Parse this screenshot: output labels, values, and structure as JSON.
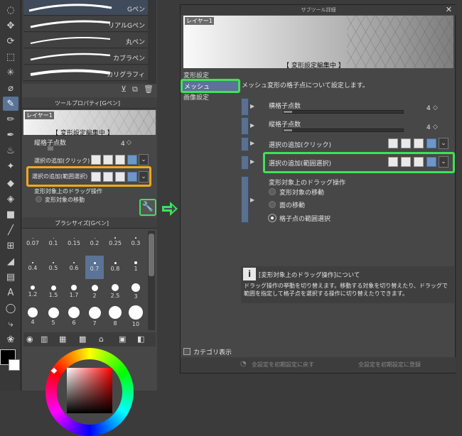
{
  "toolbar_icons": [
    "lasso-icon",
    "move-icon",
    "rotate-icon",
    "rect-select-icon",
    "magic-wand-icon",
    "eyedropper-icon",
    "pen-icon",
    "pencil-icon",
    "brush-icon",
    "airbrush-icon",
    "decoration-icon",
    "eraser-icon",
    "blend-icon",
    "fill-icon",
    "gradient-icon",
    "line-icon",
    "frame-icon",
    "ruler-icon",
    "balloon-icon",
    "text-icon",
    "speech-icon",
    "correct-line-icon",
    "layer-move-icon"
  ],
  "brushes": [
    "Gペン",
    "リアルGペン",
    "丸ペン",
    "カブラペン",
    "カリグラフィ"
  ],
  "tool_property": {
    "header": "ツールプロパティ[Gペン]",
    "canvas_layer": "レイヤー1",
    "canvas_banner": "【 変形設定編集中 】",
    "row1_label": "縦格子点数",
    "row1_value": "4",
    "row2_label": "選択の追加(クリック)",
    "row3_label": "選択の追加(範囲選択)",
    "row4_label": "変形対象上のドラッグ操作",
    "row5_label": "変形対象の移動"
  },
  "brush_size": {
    "header": "ブラシサイズ[Gペン]",
    "sizes": [
      "0.07",
      "0.1",
      "0.15",
      "0.2",
      "0.25",
      "0.3",
      "0.4",
      "0.5",
      "0.6",
      "0.7",
      "0.8",
      "1",
      "1.2",
      "1.5",
      "1.7",
      "2",
      "2.5",
      "3",
      "4",
      "5",
      "6",
      "7",
      "8",
      "10"
    ],
    "selected_index": 9
  },
  "dialog": {
    "title": "サブツール詳細",
    "canvas_layer": "レイヤー1",
    "canvas_banner": "【 変形設定編集中 】",
    "categories": [
      "変形設定",
      "メッシュ",
      "画像設定"
    ],
    "selected_category": "メッシュ",
    "description": "メッシュ変形の格子点について設定します。",
    "h_grid_label": "横格子点数",
    "h_grid_value": "4",
    "v_grid_label": "縦格子点数",
    "v_grid_value": "4",
    "add_click_label": "選択の追加(クリック)",
    "add_range_label": "選択の追加(範囲選択)",
    "drag_label": "変形対象上のドラッグ操作",
    "drag_options": [
      "変形対象の移動",
      "面の移動",
      "格子点の範囲選択"
    ],
    "drag_selected": "格子点の範囲選択",
    "info_title": "[変形対象上のドラッグ操作]について",
    "info_text": "ドラッグ操作の挙動を切り替えます。移動する対象を切り替えたり、ドラッグで範囲を指定して格子点を選択する操作に切り替えたりできます。",
    "category_checkbox": "カテゴリ表示",
    "reset_button": "全設定を初期設定に戻す",
    "register_button": "全設定を初期設定に登録"
  },
  "colors": {
    "highlight_green": "#3fe15a",
    "highlight_orange": "#f0a91c",
    "select_blue": "#5a7396"
  }
}
